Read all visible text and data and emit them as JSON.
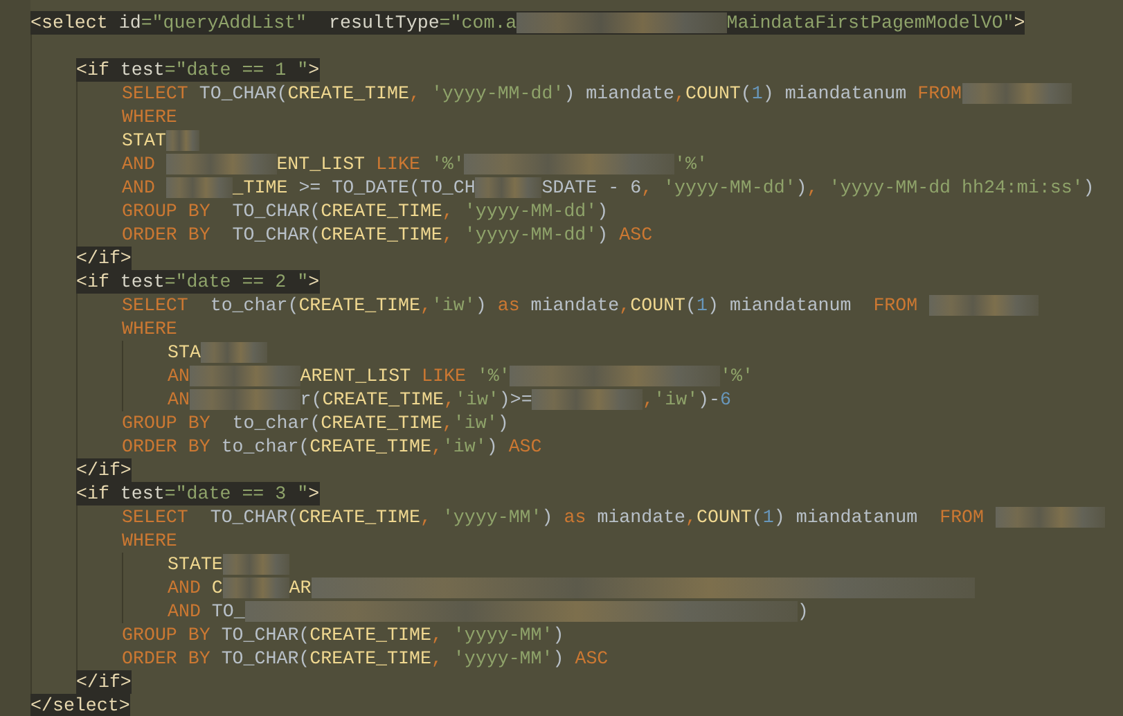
{
  "editor": {
    "root": {
      "kind": "block",
      "open": [
        {
          "text": "<select ",
          "kind": "tag"
        },
        {
          "text": "id",
          "kind": "attr"
        },
        {
          "text": "=\"",
          "kind": "tagstring"
        },
        {
          "text": "queryAddList",
          "kind": "tagstring"
        },
        {
          "text": "\"  ",
          "kind": "tagstring"
        },
        {
          "text": "resultType",
          "kind": "attr"
        },
        {
          "text": "=\"com.a",
          "kind": "tagstring"
        },
        {
          "kind": "blurlarge"
        },
        {
          "text": "MaindataFirstPagemModelVO\"",
          "kind": "tagstring"
        },
        {
          "text": ">",
          "kind": "tag"
        }
      ],
      "children": [
        {
          "kind": "block",
          "open": [
            {
              "text": "<if ",
              "kind": "tag"
            },
            {
              "text": "test",
              "kind": "attr"
            },
            {
              "text": "=\"date == 1 \"",
              "kind": "tagstring"
            },
            {
              "text": ">",
              "kind": "tag"
            }
          ],
          "children": [
            {
              "kind": "line",
              "tokens": [
                {
                  "text": "SELECT ",
                  "kind": "keyword"
                },
                {
                  "text": "TO_CHAR(",
                  "kind": "plain"
                },
                {
                  "text": "CREATE_TIME",
                  "kind": "column"
                },
                {
                  "text": ", ",
                  "kind": "keyword"
                },
                {
                  "text": "'yyyy-MM-dd'",
                  "kind": "string"
                },
                {
                  "text": ") miandate",
                  "kind": "plain"
                },
                {
                  "text": ",",
                  "kind": "keyword"
                },
                {
                  "text": "COUNT",
                  "kind": "column"
                },
                {
                  "text": "(",
                  "kind": "plain"
                },
                {
                  "text": "1",
                  "kind": "number"
                },
                {
                  "text": ") miandatanum ",
                  "kind": "plain"
                },
                {
                  "text": "FROM",
                  "kind": "keyword"
                },
                {
                  "kind": "blurmedium"
                }
              ]
            },
            {
              "kind": "line",
              "tokens": [
                {
                  "text": "WHERE",
                  "kind": "keyword"
                }
              ]
            },
            {
              "kind": "line",
              "tokens": [
                {
                  "text": "STAT",
                  "kind": "column"
                },
                {
                  "kind": "blurtiny"
                }
              ]
            },
            {
              "kind": "line",
              "tokens": [
                {
                  "text": "AND ",
                  "kind": "keyword"
                },
                {
                  "kind": "blurmedium"
                },
                {
                  "text": "ENT_LIST ",
                  "kind": "column"
                },
                {
                  "text": "LIKE ",
                  "kind": "keyword"
                },
                {
                  "text": "'%'",
                  "kind": "string"
                },
                {
                  "kind": "blurlarge"
                },
                {
                  "text": "'%'",
                  "kind": "string"
                }
              ]
            },
            {
              "kind": "line",
              "tokens": [
                {
                  "text": "AND ",
                  "kind": "keyword"
                },
                {
                  "kind": "blursmall"
                },
                {
                  "text": "_TIME ",
                  "kind": "column"
                },
                {
                  "text": ">= TO_DATE(TO_CH",
                  "kind": "plain"
                },
                {
                  "kind": "blursmall"
                },
                {
                  "text": "SDATE - 6",
                  "kind": "plain"
                },
                {
                  "text": ", ",
                  "kind": "keyword"
                },
                {
                  "text": "'yyyy-MM-dd'",
                  "kind": "string"
                },
                {
                  "text": ")",
                  "kind": "plain"
                },
                {
                  "text": ", ",
                  "kind": "keyword"
                },
                {
                  "text": "'yyyy-MM-dd hh24:mi:ss'",
                  "kind": "string"
                },
                {
                  "text": ")",
                  "kind": "plain"
                }
              ]
            },
            {
              "kind": "line",
              "tokens": [
                {
                  "text": "GROUP BY  ",
                  "kind": "keyword"
                },
                {
                  "text": "TO_CHAR(",
                  "kind": "plain"
                },
                {
                  "text": "CREATE_TIME",
                  "kind": "column"
                },
                {
                  "text": ", ",
                  "kind": "keyword"
                },
                {
                  "text": "'yyyy-MM-dd'",
                  "kind": "string"
                },
                {
                  "text": ")",
                  "kind": "plain"
                }
              ]
            },
            {
              "kind": "line",
              "tokens": [
                {
                  "text": "ORDER BY  ",
                  "kind": "keyword"
                },
                {
                  "text": "TO_CHAR(",
                  "kind": "plain"
                },
                {
                  "text": "CREATE_TIME",
                  "kind": "column"
                },
                {
                  "text": ", ",
                  "kind": "keyword"
                },
                {
                  "text": "'yyyy-MM-dd'",
                  "kind": "string"
                },
                {
                  "text": ") ",
                  "kind": "plain"
                },
                {
                  "text": "ASC",
                  "kind": "keyword"
                }
              ]
            }
          ],
          "close": [
            {
              "text": "</if>",
              "kind": "tag"
            }
          ]
        },
        {
          "kind": "block",
          "open": [
            {
              "text": "<if ",
              "kind": "tag"
            },
            {
              "text": "test",
              "kind": "attr"
            },
            {
              "text": "=\"date == 2 \"",
              "kind": "tagstring"
            },
            {
              "text": ">",
              "kind": "tag"
            }
          ],
          "children": [
            {
              "kind": "line",
              "tokens": [
                {
                  "text": "SELECT  ",
                  "kind": "keyword"
                },
                {
                  "text": "to_char(",
                  "kind": "plain"
                },
                {
                  "text": "CREATE_TIME",
                  "kind": "column"
                },
                {
                  "text": ",",
                  "kind": "keyword"
                },
                {
                  "text": "'iw'",
                  "kind": "string"
                },
                {
                  "text": ") ",
                  "kind": "plain"
                },
                {
                  "text": "as ",
                  "kind": "keyword"
                },
                {
                  "text": "miandate",
                  "kind": "plain"
                },
                {
                  "text": ",",
                  "kind": "keyword"
                },
                {
                  "text": "COUNT",
                  "kind": "column"
                },
                {
                  "text": "(",
                  "kind": "plain"
                },
                {
                  "text": "1",
                  "kind": "number"
                },
                {
                  "text": ") miandatanum  ",
                  "kind": "plain"
                },
                {
                  "text": "FROM ",
                  "kind": "keyword"
                },
                {
                  "kind": "blurmedium"
                }
              ]
            },
            {
              "kind": "line",
              "tokens": [
                {
                  "text": "WHERE",
                  "kind": "keyword"
                }
              ],
              "children": [
                {
                  "kind": "line",
                  "tokens": [
                    {
                      "text": "STA",
                      "kind": "column"
                    },
                    {
                      "kind": "blursmall"
                    }
                  ]
                },
                {
                  "kind": "line",
                  "tokens": [
                    {
                      "text": "AN",
                      "kind": "keyword"
                    },
                    {
                      "kind": "blurmedium"
                    },
                    {
                      "text": "ARENT_LIST ",
                      "kind": "column"
                    },
                    {
                      "text": "LIKE ",
                      "kind": "keyword"
                    },
                    {
                      "text": "'%'",
                      "kind": "string"
                    },
                    {
                      "kind": "blurlarge"
                    },
                    {
                      "text": "'%'",
                      "kind": "string"
                    }
                  ]
                },
                {
                  "kind": "line",
                  "tokens": [
                    {
                      "text": "AN",
                      "kind": "keyword"
                    },
                    {
                      "kind": "blurmedium"
                    },
                    {
                      "text": "r(",
                      "kind": "plain"
                    },
                    {
                      "text": "CREATE_TIME",
                      "kind": "column"
                    },
                    {
                      "text": ",",
                      "kind": "keyword"
                    },
                    {
                      "text": "'iw'",
                      "kind": "string"
                    },
                    {
                      "text": ")>=",
                      "kind": "plain"
                    },
                    {
                      "kind": "blurmedium"
                    },
                    {
                      "text": ",",
                      "kind": "keyword"
                    },
                    {
                      "text": "'iw'",
                      "kind": "string"
                    },
                    {
                      "text": ")-",
                      "kind": "plain"
                    },
                    {
                      "text": "6",
                      "kind": "number"
                    }
                  ]
                }
              ]
            },
            {
              "kind": "line",
              "tokens": [
                {
                  "text": "GROUP BY  ",
                  "kind": "keyword"
                },
                {
                  "text": "to_char(",
                  "kind": "plain"
                },
                {
                  "text": "CREATE_TIME",
                  "kind": "column"
                },
                {
                  "text": ",",
                  "kind": "keyword"
                },
                {
                  "text": "'iw'",
                  "kind": "string"
                },
                {
                  "text": ")",
                  "kind": "plain"
                }
              ]
            },
            {
              "kind": "line",
              "tokens": [
                {
                  "text": "ORDER BY ",
                  "kind": "keyword"
                },
                {
                  "text": "to_char(",
                  "kind": "plain"
                },
                {
                  "text": "CREATE_TIME",
                  "kind": "column"
                },
                {
                  "text": ",",
                  "kind": "keyword"
                },
                {
                  "text": "'iw'",
                  "kind": "string"
                },
                {
                  "text": ") ",
                  "kind": "plain"
                },
                {
                  "text": "ASC",
                  "kind": "keyword"
                }
              ]
            }
          ],
          "close": [
            {
              "text": "</if>",
              "kind": "tag"
            }
          ]
        },
        {
          "kind": "block",
          "open": [
            {
              "text": "<if ",
              "kind": "tag"
            },
            {
              "text": "test",
              "kind": "attr"
            },
            {
              "text": "=\"date == 3 \"",
              "kind": "tagstring"
            },
            {
              "text": ">",
              "kind": "tag"
            }
          ],
          "children": [
            {
              "kind": "line",
              "tokens": [
                {
                  "text": "SELECT  ",
                  "kind": "keyword"
                },
                {
                  "text": "TO_CHAR(",
                  "kind": "plain"
                },
                {
                  "text": "CREATE_TIME",
                  "kind": "column"
                },
                {
                  "text": ", ",
                  "kind": "keyword"
                },
                {
                  "text": "'yyyy-MM'",
                  "kind": "string"
                },
                {
                  "text": ") ",
                  "kind": "plain"
                },
                {
                  "text": "as ",
                  "kind": "keyword"
                },
                {
                  "text": "miandate",
                  "kind": "plain"
                },
                {
                  "text": ",",
                  "kind": "keyword"
                },
                {
                  "text": "COUNT",
                  "kind": "column"
                },
                {
                  "text": "(",
                  "kind": "plain"
                },
                {
                  "text": "1",
                  "kind": "number"
                },
                {
                  "text": ") miandatanum  ",
                  "kind": "plain"
                },
                {
                  "text": "FROM ",
                  "kind": "keyword"
                },
                {
                  "kind": "blurmedium"
                }
              ]
            },
            {
              "kind": "line",
              "tokens": [
                {
                  "text": "WHERE",
                  "kind": "keyword"
                }
              ],
              "children": [
                {
                  "kind": "line",
                  "tokens": [
                    {
                      "text": "STATE",
                      "kind": "column"
                    },
                    {
                      "kind": "blursmall"
                    }
                  ]
                },
                {
                  "kind": "line",
                  "tokens": [
                    {
                      "text": "AND ",
                      "kind": "keyword"
                    },
                    {
                      "text": "C",
                      "kind": "column"
                    },
                    {
                      "kind": "blursmall"
                    },
                    {
                      "text": "AR",
                      "kind": "column"
                    },
                    {
                      "kind": "blurhuge"
                    }
                  ]
                },
                {
                  "kind": "line",
                  "tokens": [
                    {
                      "text": "AND ",
                      "kind": "keyword"
                    },
                    {
                      "text": "TO_",
                      "kind": "plain"
                    },
                    {
                      "kind": "blurwide"
                    },
                    {
                      "text": ")",
                      "kind": "plain"
                    }
                  ]
                }
              ]
            },
            {
              "kind": "line",
              "tokens": [
                {
                  "text": "GROUP BY ",
                  "kind": "keyword"
                },
                {
                  "text": "TO_CHAR(",
                  "kind": "plain"
                },
                {
                  "text": "CREATE_TIME",
                  "kind": "column"
                },
                {
                  "text": ", ",
                  "kind": "keyword"
                },
                {
                  "text": "'yyyy-MM'",
                  "kind": "string"
                },
                {
                  "text": ")",
                  "kind": "plain"
                }
              ]
            },
            {
              "kind": "line",
              "tokens": [
                {
                  "text": "ORDER BY ",
                  "kind": "keyword"
                },
                {
                  "text": "TO_CHAR(",
                  "kind": "plain"
                },
                {
                  "text": "CREATE_TIME",
                  "kind": "column"
                },
                {
                  "text": ", ",
                  "kind": "keyword"
                },
                {
                  "text": "'yyyy-MM'",
                  "kind": "string"
                },
                {
                  "text": ") ",
                  "kind": "plain"
                },
                {
                  "text": "ASC",
                  "kind": "keyword"
                }
              ]
            }
          ],
          "close": [
            {
              "text": "</if>",
              "kind": "tag"
            }
          ]
        }
      ],
      "close": [
        {
          "text": "</select>",
          "kind": "tag"
        }
      ]
    }
  }
}
